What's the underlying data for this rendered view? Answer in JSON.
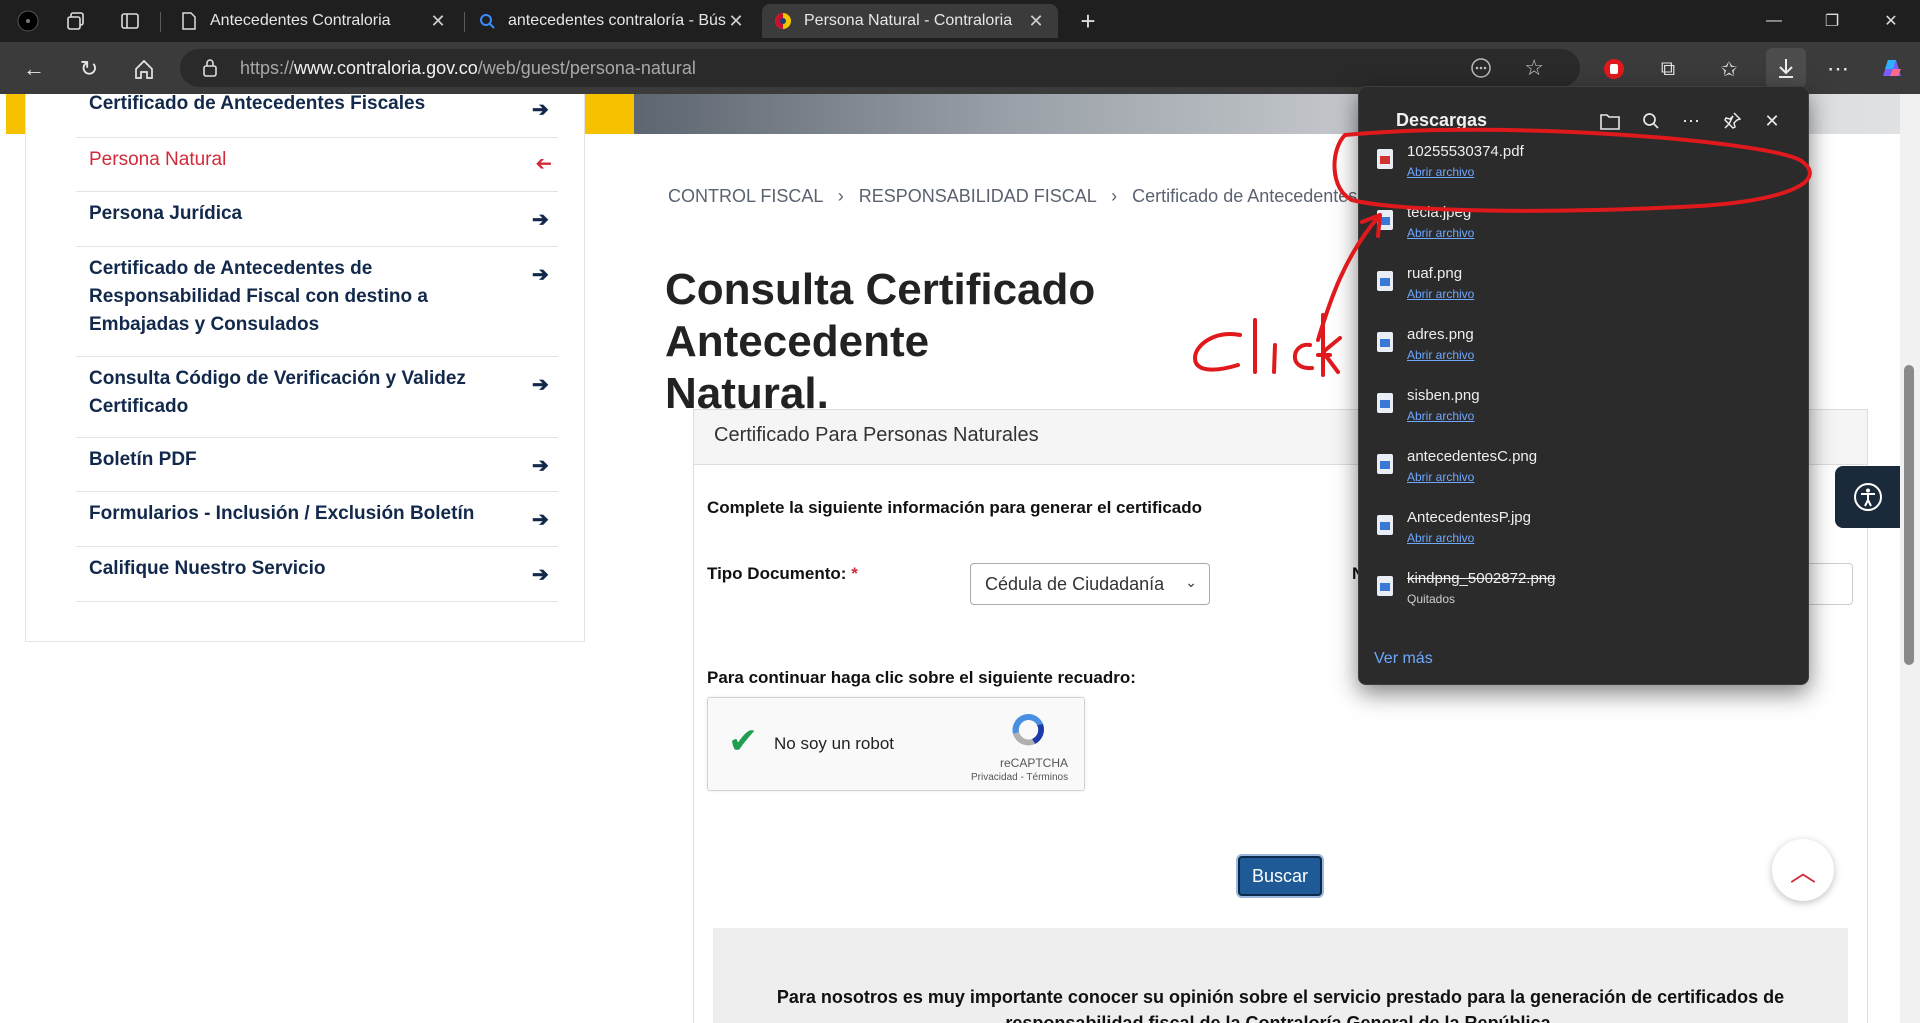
{
  "browser": {
    "tabs": [
      {
        "title": "Antecedentes Contraloria"
      },
      {
        "title": "antecedentes contraloría - Búsqu"
      },
      {
        "title": "Persona Natural - Contraloria"
      }
    ],
    "url": {
      "prefix": "https://",
      "host": "www.contraloria.gov.co",
      "path": "/web/guest/persona-natural"
    }
  },
  "sidebar": {
    "items": [
      {
        "label": "Certificado de Antecedentes Fiscales"
      },
      {
        "label": "Persona Natural"
      },
      {
        "label": "Persona Jurídica"
      },
      {
        "label": "Certificado de Antecedentes de Responsabilidad Fiscal con destino a Embajadas y Consulados"
      },
      {
        "label": "Consulta Código de Verificación y Validez Certificado"
      },
      {
        "label": "Boletín PDF"
      },
      {
        "label": "Formularios - Inclusión / Exclusión Boletín"
      },
      {
        "label": "Califique Nuestro Servicio"
      }
    ]
  },
  "breadcrumb": {
    "items": [
      "CONTROL FISCAL",
      "RESPONSABILIDAD FISCAL",
      "Certificado de Antecedentes Fisc"
    ],
    "separator": "›"
  },
  "main": {
    "title": "Consulta Certificado Antecedente Natural.",
    "title_line1": "Consulta Certificado Antecedente",
    "title_line2": "Natural.",
    "card_header": "Certificado Para Personas Naturales",
    "form_intro": "Complete la siguiente información para generar el certificado",
    "tipo_label": "Tipo Documento:",
    "required_mark": "*",
    "tipo_value": "Cédula de Ciudadanía",
    "num_label_partial": "N",
    "continue_label": "Para continuar haga clic sobre el siguiente recuadro:",
    "captcha": {
      "label": "No soy un robot",
      "brand": "reCAPTCHA",
      "terms": "Privacidad - Términos"
    },
    "buscar_label": "Buscar",
    "survey_text": "Para nosotros es muy importante conocer su opinión sobre el servicio prestado para la generación de certificados de responsabilidad fiscal de la Contraloría General de la República."
  },
  "downloads": {
    "title": "Descargas",
    "items": [
      {
        "name": "10255530374.pdf",
        "action": "Abrir archivo",
        "type": "pdf"
      },
      {
        "name": "tecla.jpeg",
        "action": "Abrir archivo",
        "type": "image"
      },
      {
        "name": "ruaf.png",
        "action": "Abrir archivo",
        "type": "image"
      },
      {
        "name": "adres.png",
        "action": "Abrir archivo",
        "type": "image"
      },
      {
        "name": "sisben.png",
        "action": "Abrir archivo",
        "type": "image"
      },
      {
        "name": "antecedentesC.png",
        "action": "Abrir archivo",
        "type": "image"
      },
      {
        "name": "AntecedentesP.jpg",
        "action": "Abrir archivo",
        "type": "image"
      },
      {
        "name": "kindpng_5002872.png",
        "action": "Quitados",
        "type": "image",
        "removed": true
      }
    ],
    "see_more": "Ver más"
  },
  "annotation": {
    "text": "Click",
    "color": "#e0191d"
  },
  "colors": {
    "accent_red": "#d02b3b",
    "navy": "#13294b",
    "yellow": "#f6c200",
    "button_blue": "#1f5a96"
  }
}
